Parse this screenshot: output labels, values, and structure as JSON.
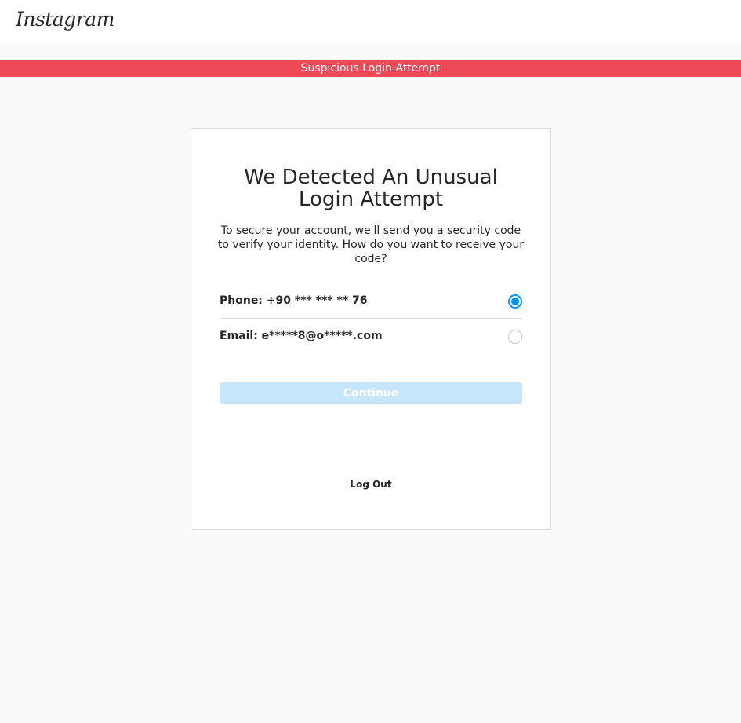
{
  "header": {
    "logo_text": "Instagram"
  },
  "banner": {
    "text": "Suspicious Login Attempt",
    "color": "#ed4956"
  },
  "card": {
    "title": "We Detected An Unusual Login Attempt",
    "description": "To secure your account, we'll send you a security code to verify your identity. How do you want to receive your code?",
    "options": [
      {
        "label": "Phone: +90 *** *** ** 76",
        "selected": true
      },
      {
        "label": "Email: e*****8@o*****.com",
        "selected": false
      }
    ],
    "continue_label": "Continue",
    "logout_label": "Log Out"
  },
  "colors": {
    "accent": "#0095f6",
    "button_disabled": "#c7e6fb"
  }
}
